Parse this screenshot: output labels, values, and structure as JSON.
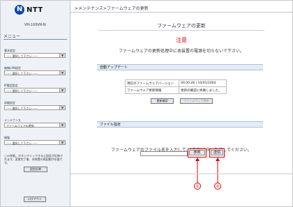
{
  "logo": {
    "mark": "N",
    "brand": "NTT"
  },
  "sidebar": {
    "model": "VH-100VR-N",
    "menu_title": "メニュー",
    "sections": [
      {
        "label": "基本設定",
        "select_value": "----- 選択して下さい -----"
      },
      {
        "label": "無線LAN設定",
        "select_value": "----- 選択して下さい -----"
      },
      {
        "label": "IP電話設定",
        "select_value": "----- 選択して下さい -----"
      },
      {
        "label": "詳細設定",
        "select_value": "----- 選択して下さい -----"
      },
      {
        "label": "メンテナンス",
        "select_value": "ファームウェアの更新"
      },
      {
        "label": "情報",
        "select_value": "----- 選択して下さい -----"
      }
    ],
    "note": "この状態。ボタンクリックすると設定が反映されます。変更完了後、本装置の再起動が必要です。",
    "save_button": "設定反映",
    "logout_button": "ログアウト"
  },
  "breadcrumb": ">メンテナンス>ファームウェアの更新",
  "page_title": "ファームウェアの更新",
  "warning": {
    "heading": "注意",
    "text": "ファームウェアの更新処理中に本装置の電源を切らないで下さい。"
  },
  "auto_update": {
    "header": "自動アップデート",
    "rows": [
      {
        "label": "現在のファームウェアバージョン",
        "value": "00.00.28 | 10/01/2004"
      },
      {
        "label": "ファームウェア更新情報",
        "value": "更新の確認に失敗しました。"
      }
    ],
    "check_button": "更新確認",
    "update_button": "ファームウェア更新"
  },
  "file_spec": {
    "header": "ファイル指定",
    "instruction": "ファームウェアのファイル名を入力して、[送信]ボタンを押してください。",
    "browse_button": "参照",
    "send_button": "送信"
  },
  "callouts": [
    "①",
    "②"
  ],
  "colors": {
    "accent": "#0b47a8",
    "warning": "#d40000",
    "highlight": "#e00000",
    "section_bg": "#e3ecf7"
  }
}
